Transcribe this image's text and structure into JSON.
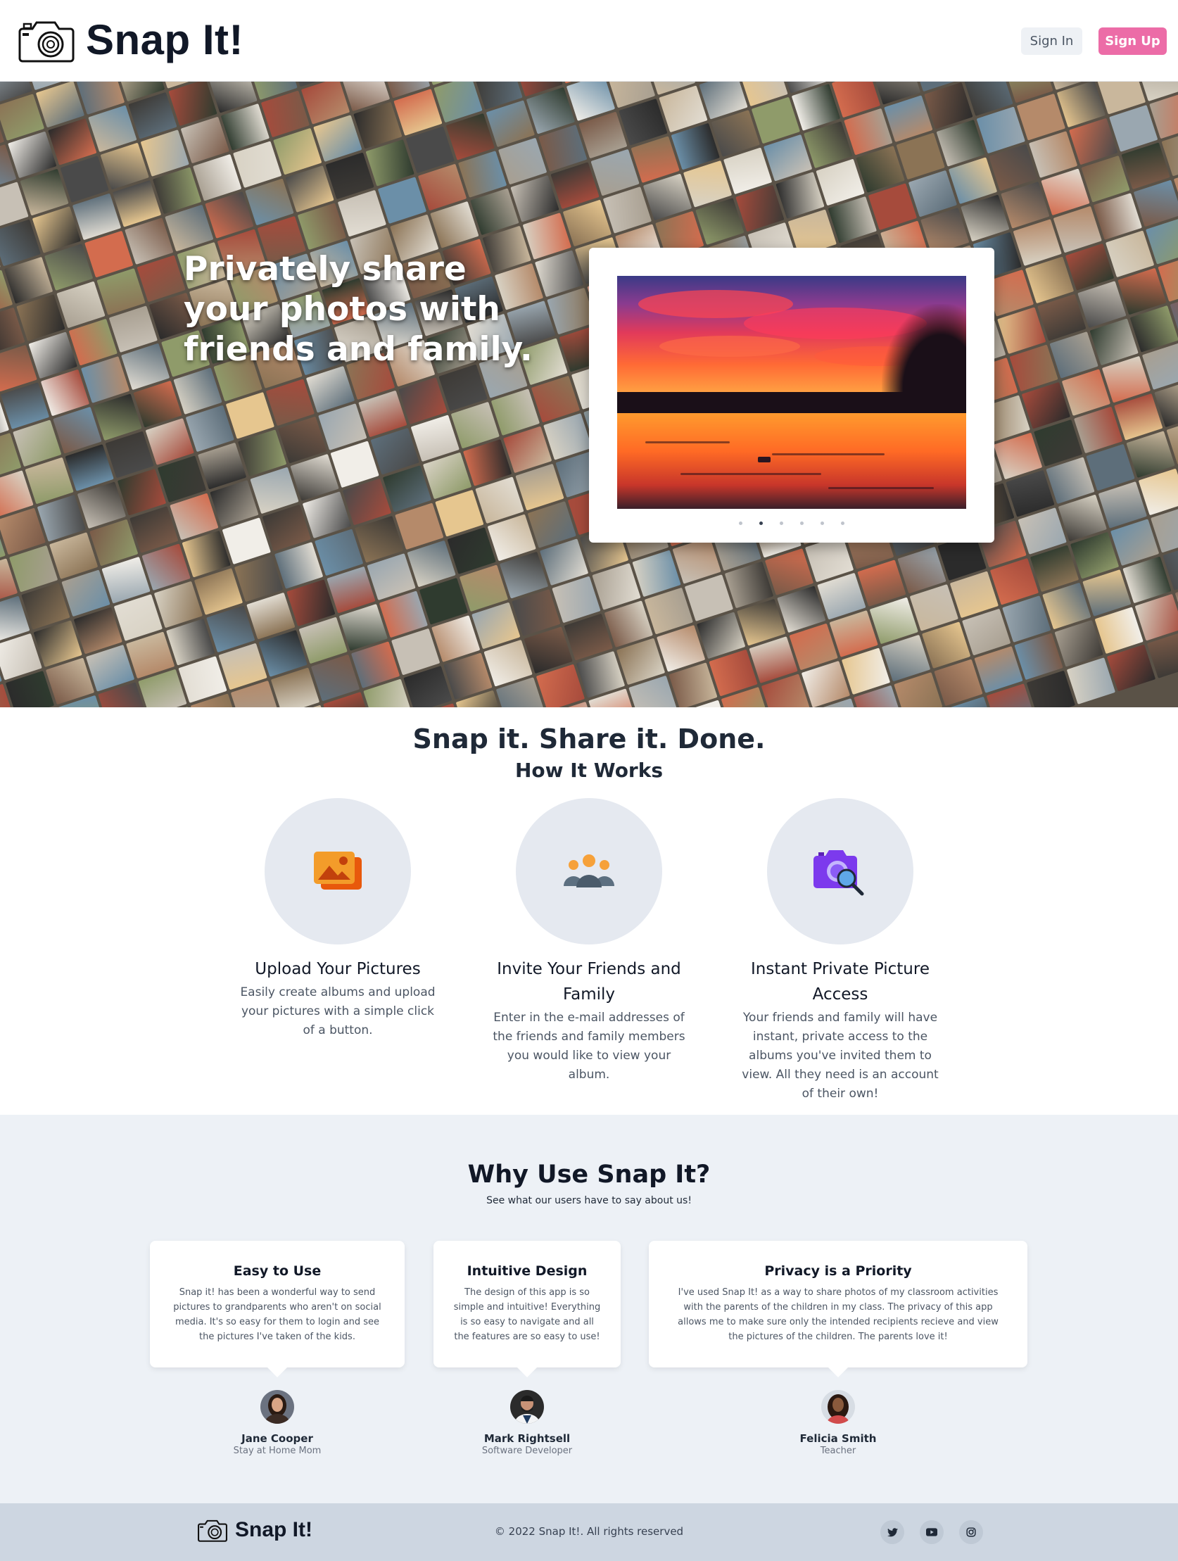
{
  "header": {
    "brand": "Snap It!",
    "sign_in": "Sign In",
    "sign_up": "Sign Up"
  },
  "hero": {
    "headline": "Privately share your photos with friends and family.",
    "slider": {
      "slide_count": 6,
      "active_index": 1
    }
  },
  "how": {
    "title": "Snap it. Share it. Done.",
    "subtitle": "How It Works",
    "features": [
      {
        "icon": "images-icon",
        "title": "Upload Your Pictures",
        "text": "Easily create albums and upload your pictures with a simple click of a button."
      },
      {
        "icon": "people-icon",
        "title": "Invite Your Friends and Family",
        "text": "Enter in the e-mail addresses of the friends and family members you would like to view your album."
      },
      {
        "icon": "camera-search-icon",
        "title": "Instant Private Picture Access",
        "text": "Your friends and family will have instant, private access to the albums you've invited them to view. All they need is an account of their own!"
      }
    ]
  },
  "why": {
    "title": "Why Use Snap It?",
    "subtitle": "See what our users have to say about us!",
    "testimonials": [
      {
        "title": "Easy to Use",
        "text": "Snap it! has been a wonderful way to send pictures to grandparents who aren't on social media. It's so easy for them to login and see the pictures I've taken of the kids.",
        "name": "Jane Cooper",
        "role": "Stay at Home Mom"
      },
      {
        "title": "Intuitive Design",
        "text": "The design of this app is so simple and intuitive! Everything is so easy to navigate and all the features are so easy to use!",
        "name": "Mark Rightsell",
        "role": "Software Developer"
      },
      {
        "title": "Privacy is a Priority",
        "text": "I've used Snap It! as a way to share photos of my classroom activities with the parents of the children in my class. The privacy of this app allows me to make sure only the intended recipients recieve and view the pictures of the children. The parents love it!",
        "name": "Felicia Smith",
        "role": "Teacher"
      }
    ]
  },
  "footer": {
    "brand": "Snap It!",
    "copyright": "© 2022 Snap It!. All rights reserved",
    "social": [
      "twitter-icon",
      "youtube-icon",
      "instagram-icon"
    ]
  },
  "colors": {
    "accent": "#ec6ca7",
    "footer_bg": "#cdd6e1",
    "section_bg": "#edf1f6",
    "icon_circle": "#e5e9f0"
  }
}
